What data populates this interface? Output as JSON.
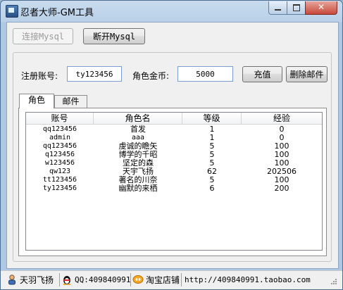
{
  "window": {
    "title": "忍者大师-GM工具"
  },
  "toolbar": {
    "connect_label": "连接Mysql",
    "disconnect_label": "断开Mysql"
  },
  "form": {
    "account_label": "注册账号:",
    "account_value": "ty123456",
    "gold_label": "角色金币:",
    "gold_value": "5000",
    "recharge_label": "充值",
    "delete_mail_label": "删除邮件"
  },
  "tabs": [
    {
      "label": "角色"
    },
    {
      "label": "邮件"
    }
  ],
  "table": {
    "columns": [
      "账号",
      "角色名",
      "等级",
      "经验"
    ],
    "rows": [
      [
        "qq123456",
        "首发",
        "1",
        "0"
      ],
      [
        "admin",
        "aaa",
        "1",
        "0"
      ],
      [
        "qq123456",
        "虔诚的瞻矢",
        "5",
        "100"
      ],
      [
        "q123456",
        "博学的千昭",
        "5",
        "100"
      ],
      [
        "w123456",
        "坚定的森",
        "5",
        "100"
      ],
      [
        "qw123",
        "天宇飞扬",
        "62",
        "202506"
      ],
      [
        "tt123456",
        "著名的川奈",
        "5",
        "100"
      ],
      [
        "ty123456",
        "幽默的来栖",
        "6",
        "200"
      ]
    ]
  },
  "statusbar": {
    "user": "天羽飞扬",
    "qq": "QQ:409840991",
    "shop": "淘宝店铺",
    "url": "http://409840991.taobao.com"
  }
}
